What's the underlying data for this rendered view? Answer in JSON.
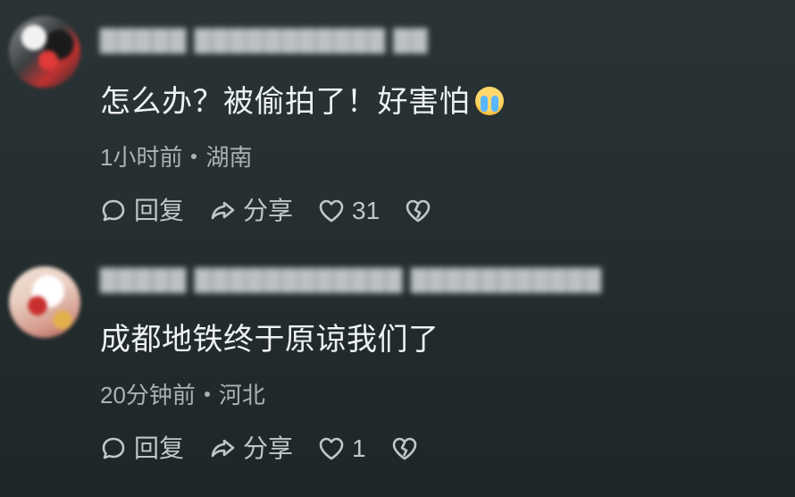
{
  "comments": [
    {
      "username": "█████ ███████████ ██",
      "text": "怎么办？被偷拍了！好害怕",
      "emoji": "crying-face-emoji",
      "time": "1小时前",
      "location": "湖南",
      "actions": {
        "reply": "回复",
        "share": "分享",
        "likes": "31"
      }
    },
    {
      "username": "█████ ████████████ ███████████",
      "text": "成都地铁终于原谅我们了",
      "time": "20分钟前",
      "location": "河北",
      "actions": {
        "reply": "回复",
        "share": "分享",
        "likes": "1"
      }
    }
  ],
  "colors": {
    "background_top": "#2a3335",
    "background_bottom": "#1f2628",
    "text_primary": "#eef2f2",
    "text_secondary": "#aab2b4",
    "icon": "#c1c7c8"
  }
}
